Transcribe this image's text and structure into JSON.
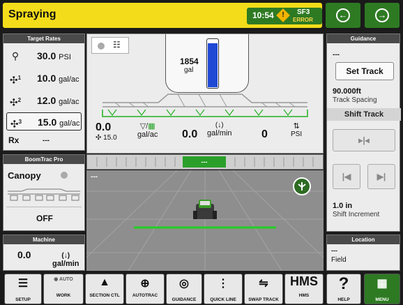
{
  "header": {
    "title": "Spraying",
    "time": "10:54",
    "alert_code": "SF3",
    "alert_status": "ERROR",
    "back_icon": "arrow-left-circle-icon",
    "forward_icon": "arrow-right-circle-icon",
    "accent": "#2e7a23",
    "title_bg": "#f3dd1a"
  },
  "target_rates": {
    "title": "Target Rates",
    "rows": [
      {
        "icon": "pressure-gauge-icon",
        "value": "30.0",
        "unit": "PSI"
      },
      {
        "icon": "product-1-icon",
        "sup": "1",
        "value": "10.0",
        "unit": "gal/ac"
      },
      {
        "icon": "product-2-icon",
        "sup": "2",
        "value": "12.0",
        "unit": "gal/ac"
      },
      {
        "icon": "product-3-icon",
        "sup": "3",
        "value": "15.0",
        "unit": "gal/ac"
      }
    ],
    "rx_label": "Rx",
    "rx_value": "---"
  },
  "boomtrac": {
    "title": "BoomTrac Pro",
    "mode": "Canopy",
    "state": "OFF"
  },
  "machine": {
    "title": "Machine",
    "value": "0.0",
    "unit": "gal/min"
  },
  "tank": {
    "volume": "1854",
    "unit": "gal",
    "fill_level": 0.9,
    "fill_color": "#1f49d4"
  },
  "readouts": {
    "rate_value": "0.0",
    "rate_target": "15.0",
    "rate_unit": "gal/ac",
    "flow_value": "0.0",
    "flow_unit": "gal/min",
    "pressure_value": "0",
    "pressure_unit": "PSI"
  },
  "section_bar": {
    "active_label": "---"
  },
  "map": {
    "status": "---",
    "line_color": "#21d021"
  },
  "guidance": {
    "title": "Guidance",
    "status": "---",
    "set_track": "Set Track",
    "spacing_value": "90.000ft",
    "spacing_label": "Track Spacing",
    "shift_track": "Shift Track",
    "increment_value": "1.0 in",
    "increment_label": "Shift Increment"
  },
  "location": {
    "title": "Location",
    "value": "---",
    "field": "Field"
  },
  "toolbar": [
    {
      "name": "setup",
      "label": "SETUP",
      "icon": "setup-list-icon"
    },
    {
      "name": "work",
      "label": "WORK",
      "top": "AUTO",
      "icon": "work-auto-icon"
    },
    {
      "name": "section-ctl",
      "label": "SECTION CTL",
      "icon": "section-control-icon"
    },
    {
      "name": "autotrac",
      "label": "AUTOTRAC",
      "icon": "autotrac-icon"
    },
    {
      "name": "guidance",
      "label": "GUIDANCE",
      "icon": "guidance-icon"
    },
    {
      "name": "quick-line",
      "label": "QUICK LINE",
      "icon": "quick-line-icon"
    },
    {
      "name": "swap-track",
      "label": "SWAP TRACK",
      "icon": "swap-track-icon"
    },
    {
      "name": "hms",
      "label": "HMS",
      "top": "HMS",
      "icon": "hms-icon"
    },
    {
      "name": "help",
      "label": "HELP",
      "top": "?",
      "icon": "help-icon"
    },
    {
      "name": "menu",
      "label": "MENU",
      "icon": "menu-grid-icon"
    }
  ]
}
